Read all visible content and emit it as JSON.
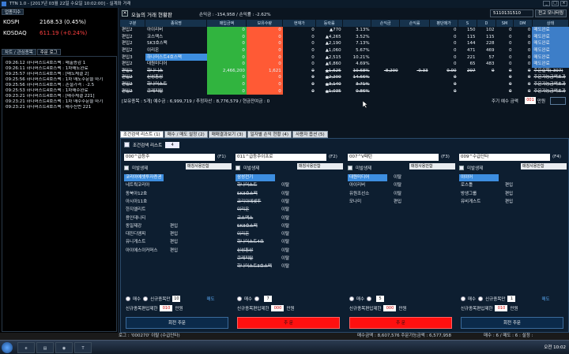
{
  "window": {
    "title": "TTN 1.0 - [2017년 03월 22일 수요일 10:02:00] - 실계좌 거래"
  },
  "left_panel": {
    "tab": "업종지수",
    "indices": [
      {
        "name": "KOSPI",
        "value": "2168.53 (0.45%)",
        "color": "#ffffff"
      },
      {
        "name": "KOSDAQ",
        "value": "611.19 (+0.24%)",
        "color": "#ff4040"
      }
    ],
    "log_tabs": [
      "차트 / 관심종목",
      "주문 로그"
    ],
    "log_lines": [
      "09:26:12 하나머스트4호스팩 : 매출증감 1",
      "09:26:11 하나머스트4호스팩 : 1차매도완료",
      "09:25:57 하나머스트4호스팩 : [매도체결 2]",
      "09:25:56 하나머스트4호스팩 : 1차 매도주문을 마기",
      "09:25:56 하나머스트4호스팩 : 손절가격 : -2.5",
      "09:25:53 하나머스트4호스팩 : 1차매수완료",
      "09:23:21 하나머스트4호스팩 : [매수체결 221]",
      "09:23:21 하나머스트4호스팩 : 1차 매수주문을 마기",
      "09:23:21 하나머스트4호스팩 : 매수신번 221"
    ]
  },
  "top": {
    "title": "오늘의 거래 현황판",
    "profit_label": "손익금 : -154,958 / 손익률 : -2.62%",
    "account": "5110131510",
    "account_btn": "전고 모니터링",
    "columns": [
      "구분",
      "종목명",
      "매입금액",
      "보유수량",
      "현재가",
      "등락률",
      "손익금",
      "손익률",
      "평단매가",
      "S",
      "D",
      "SM",
      "DM",
      "상태"
    ],
    "rows": [
      {
        "gubun": "편입2",
        "name": "아이리버",
        "buy": "0",
        "qty": "0",
        "price": "0",
        "rate": "▲770",
        "rate2": "3.13%",
        "pnl": "",
        "pct": "",
        "avg": "0",
        "s": "150",
        "d": "102",
        "sm": "0",
        "dm": "0",
        "status": "매도완료",
        "strike": false
      },
      {
        "gubun": "편입2",
        "name": "코스맥스",
        "buy": "0",
        "qty": "0",
        "price": "0",
        "rate": "▲4,265",
        "rate2": "3.52%",
        "pnl": "",
        "pct": "",
        "avg": "0",
        "s": "115",
        "d": "115",
        "sm": "0",
        "dm": "0",
        "status": "매도완료",
        "strike": false
      },
      {
        "gubun": "편입2",
        "name": "SK3호스팩",
        "buy": "0",
        "qty": "0",
        "price": "0",
        "rate": "▲2,190",
        "rate2": "7.13%",
        "pnl": "",
        "pct": "",
        "avg": "0",
        "s": "144",
        "d": "228",
        "sm": "0",
        "dm": "0",
        "status": "매도완료",
        "strike": false
      },
      {
        "gubun": "편입2",
        "name": "이리온",
        "buy": "0",
        "qty": "0",
        "price": "0",
        "rate": "▲1,060",
        "rate2": "5.67%",
        "pnl": "",
        "pct": "",
        "avg": "0",
        "s": "471",
        "d": "469",
        "sm": "0",
        "dm": "0",
        "status": "매도완료",
        "strike": false
      },
      {
        "gubun": "편입3",
        "name": "하나머스트4호스팩",
        "buy": "0",
        "qty": "0",
        "price": "0",
        "rate": "▲2,515",
        "rate2": "10.21%",
        "pnl": "",
        "pct": "",
        "avg": "0",
        "s": "221",
        "d": "57",
        "sm": "0",
        "dm": "0",
        "status": "매도완료",
        "strike": false
      },
      {
        "gubun": "편입2",
        "name": "대원미디어",
        "buy": "0",
        "qty": "0",
        "price": "0",
        "rate": "▲6,860",
        "rate2": "4.69%",
        "pnl": "",
        "pct": "",
        "avg": "0",
        "s": "65",
        "d": "483",
        "sm": "0",
        "dm": "0",
        "status": "매도완료",
        "strike": false
      },
      {
        "gubun": "편입1",
        "name": "하나니스",
        "buy": "2,466,200",
        "qty": "1,621",
        "price": "0",
        "rate": "▲1,625",
        "rate2": "10.68%",
        "pnl": "-8,200",
        "pct": "-0.33",
        "avg": "0.00",
        "s": "207",
        "d": "0",
        "sm": "0",
        "dm": "0",
        "status": "주문실패(-307)",
        "strike": true
      },
      {
        "gubun": "편입2",
        "name": "신성통상",
        "buy": "0",
        "qty": "0",
        "price": "0",
        "rate": "▲2,200",
        "rate2": "14.66%",
        "pnl": "",
        "pct": "",
        "avg": "0",
        "s": "",
        "d": "",
        "sm": "0",
        "dm": "0",
        "status": "주문가능금액초과",
        "strike": true
      },
      {
        "gubun": "편입2",
        "name": "하나머스트",
        "buy": "0",
        "qty": "0",
        "price": "0",
        "rate": "▲3,140",
        "rate2": "3.71%",
        "pnl": "",
        "pct": "",
        "avg": "0",
        "s": "",
        "d": "",
        "sm": "0",
        "dm": "0",
        "status": "주문가능금액초과",
        "strike": true
      },
      {
        "gubun": "편입2",
        "name": "큐캐피탈",
        "buy": "0",
        "qty": "0",
        "price": "0",
        "rate": "▲1,035",
        "rate2": "0.86%",
        "pnl": "",
        "pct": "",
        "avg": "0",
        "s": "",
        "d": "",
        "sm": "0",
        "dm": "0",
        "status": "주문가능금액초과",
        "strike": true
      }
    ],
    "summary": "[보유종목 : 5개]     예수금 : 6,999,719  /  추정자산 : 8,776,579  /  현금잔여금 : 0",
    "order_label": "주기 예수 금액",
    "order_value": "001",
    "order_unit": "만원"
  },
  "main_tabs": [
    "조건검색 리스트 (1)",
    "매수 / 매도 설정 (2)",
    "매매결과보기 (3)",
    "일자별 손익 현황 (4)",
    "사용자 옵션 (5)"
  ],
  "lower": {
    "cond_label": "조건검색 리스트",
    "cond_count": "4",
    "columns": [
      {
        "combo": "000^급등주",
        "ftag": "(F1)",
        "opt_label": "미발생제",
        "opt2": "매칭사용안함",
        "stocks": [
          {
            "n": "코리아에셋투자증권",
            "t": "",
            "sel": true,
            "s": false
          },
          {
            "n": "네트웍코리아",
            "t": "",
            "sel": false,
            "s": false
          },
          {
            "n": "동북아12호",
            "t": "",
            "sel": false,
            "s": false
          },
          {
            "n": "아시아11호",
            "t": "",
            "sel": false,
            "s": false
          },
          {
            "n": "한지엘리트",
            "t": "",
            "sel": false,
            "s": false
          },
          {
            "n": "용인데니티",
            "t": "",
            "sel": false,
            "s": false
          },
          {
            "n": "동일제강",
            "t": "편입",
            "sel": false,
            "s": false
          },
          {
            "n": "대진디엠피",
            "t": "편입",
            "sel": false,
            "s": false
          },
          {
            "n": "유니게스트",
            "t": "편입",
            "sel": false,
            "s": false
          },
          {
            "n": "아이에스이커머스",
            "t": "편입",
            "sel": false,
            "s": false
          }
        ],
        "ctrl": {
          "r1": "신규종목만",
          "r1v": "10",
          "r1b": "매도",
          "r2": "신규종목편입제한",
          "r2v": "010",
          "r2u": "만원",
          "btn": "회전 주문",
          "btnstyle": "blue"
        }
      },
      {
        "combo": "011^급등주이프로",
        "ftag": "(F2)",
        "opt_label": "미발생제",
        "opt2": "매칭사용안함",
        "stocks": [
          {
            "n": "삼성전기",
            "t": "",
            "sel": true,
            "s": false
          },
          {
            "n": "하나머스트",
            "t": "이탈",
            "sel": false,
            "s": true
          },
          {
            "n": "SK3호스팩",
            "t": "이탈",
            "sel": false,
            "s": true
          },
          {
            "n": "코리아에셋투",
            "t": "이탈",
            "sel": false,
            "s": true
          },
          {
            "n": "이리온",
            "t": "이탈",
            "sel": false,
            "s": true
          },
          {
            "n": "코스맥스",
            "t": "이탈",
            "sel": false,
            "s": true
          },
          {
            "n": "SK3호스팩",
            "t": "이탈",
            "sel": false,
            "s": true
          },
          {
            "n": "이리온",
            "t": "이탈",
            "sel": false,
            "s": true
          },
          {
            "n": "하나머스트4호",
            "t": "이탈",
            "sel": false,
            "s": true
          },
          {
            "n": "신성통상",
            "t": "이탈",
            "sel": false,
            "s": true
          },
          {
            "n": "큐캐피탈",
            "t": "이탈",
            "sel": false,
            "s": true
          },
          {
            "n": "하나머스트3호스팩",
            "t": "이탈",
            "sel": false,
            "s": true
          }
        ],
        "ctrl": {
          "r1": "",
          "r1v": "7",
          "r1b": "",
          "r2": "신규종목편입제한",
          "r2v": "000",
          "r2u": "만원",
          "btn": "주 문",
          "btnstyle": "red"
        }
      },
      {
        "combo": "007^V패턴",
        "ftag": "(F3)",
        "opt_label": "미발생제",
        "opt2": "매칭사용안함",
        "stocks": [
          {
            "n": "대원미디어",
            "t": "이탈",
            "sel": true,
            "s": false
          },
          {
            "n": "아이리버",
            "t": "이탈",
            "sel": false,
            "s": false
          },
          {
            "n": "유원조선소",
            "t": "이탈",
            "sel": false,
            "s": false
          },
          {
            "n": "모나미",
            "t": "편입",
            "sel": false,
            "s": false
          }
        ],
        "ctrl": {
          "r1": "",
          "r1v": "5",
          "r1b": "",
          "r2": "신규종목편입제한",
          "r2v": "000",
          "r2u": "만원",
          "btn": "주 문",
          "btnstyle": "red"
        }
      },
      {
        "combo": "009^수급단타",
        "ftag": "(F4)",
        "opt_label": "미발생제",
        "opt2": "매칭사용안함",
        "stocks": [
          {
            "n": "이이어",
            "t": "",
            "sel": true,
            "s": false
          },
          {
            "n": "로스틀",
            "t": "편입",
            "sel": false,
            "s": false
          },
          {
            "n": "방생그룹",
            "t": "편입",
            "sel": false,
            "s": false
          },
          {
            "n": "유비게스트",
            "t": "편입",
            "sel": false,
            "s": false
          }
        ],
        "ctrl": {
          "r1": "신규종목만",
          "r1v": "1",
          "r1b": "매도",
          "r2": "신규종목편입제한",
          "r2v": "010",
          "r2u": "만원",
          "btn": "회전 주문",
          "btnstyle": "blue"
        }
      }
    ]
  },
  "status_bar": {
    "left": "로그 : '000270' 이탈 (수급단타)",
    "mid": "매수금액 : 8,607,576 주문가능금액 : 6,577,958",
    "right": "매수 : 6 / 매도 : 6     :  설정 :"
  },
  "taskbar": {
    "clock": "오전 10:02"
  }
}
